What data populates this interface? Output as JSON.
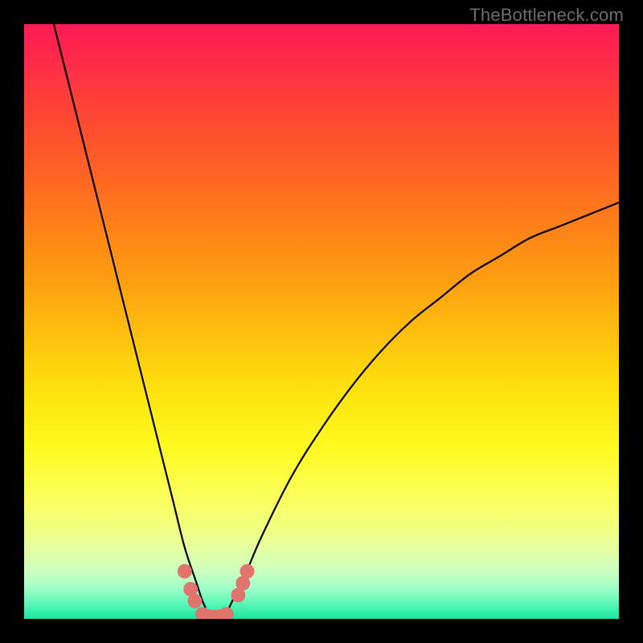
{
  "watermark": "TheBottleneck.com",
  "colors": {
    "frame": "#000000",
    "watermark": "#6d6d6d",
    "curve_stroke": "#000000",
    "marker_fill": "#e2746e",
    "gradient_top": "#ff1a55",
    "gradient_bottom": "#17e79f"
  },
  "chart_data": {
    "type": "line",
    "title": "",
    "xlabel": "",
    "ylabel": "",
    "xlim": [
      0,
      100
    ],
    "ylim": [
      0,
      100
    ],
    "grid": false,
    "legend": false,
    "annotations": [
      "TheBottleneck.com"
    ],
    "description": "Bottleneck curve: percentage of bottleneck vs a hidden horizontal parameter. Minimum near x≈32, steep rise on both sides; right branch tops out around y≈70 at x=100. Background gradient encodes severity (green=0%→red=100%). A few salmon markers cluster near the minimum.",
    "series": [
      {
        "name": "bottleneck-curve",
        "x": [
          5,
          8,
          12,
          16,
          20,
          23,
          25,
          27,
          29,
          30,
          31,
          32,
          33,
          34,
          35,
          37,
          40,
          45,
          50,
          55,
          60,
          65,
          70,
          75,
          80,
          85,
          90,
          95,
          100
        ],
        "y": [
          100,
          88,
          72,
          56,
          40,
          28,
          20,
          12,
          6,
          3,
          1,
          0.3,
          0.3,
          1,
          3,
          7,
          14,
          24,
          32,
          39,
          45,
          50,
          54,
          58,
          61,
          64,
          66,
          68,
          70
        ]
      }
    ],
    "markers": [
      {
        "x": 27.0,
        "y": 8.0
      },
      {
        "x": 28.0,
        "y": 5.0
      },
      {
        "x": 28.7,
        "y": 3.0
      },
      {
        "x": 30.0,
        "y": 0.8
      },
      {
        "x": 31.0,
        "y": 0.4
      },
      {
        "x": 32.0,
        "y": 0.3
      },
      {
        "x": 33.0,
        "y": 0.4
      },
      {
        "x": 34.0,
        "y": 0.8
      },
      {
        "x": 36.0,
        "y": 4.0
      },
      {
        "x": 36.8,
        "y": 6.0
      },
      {
        "x": 37.5,
        "y": 8.0
      }
    ]
  }
}
